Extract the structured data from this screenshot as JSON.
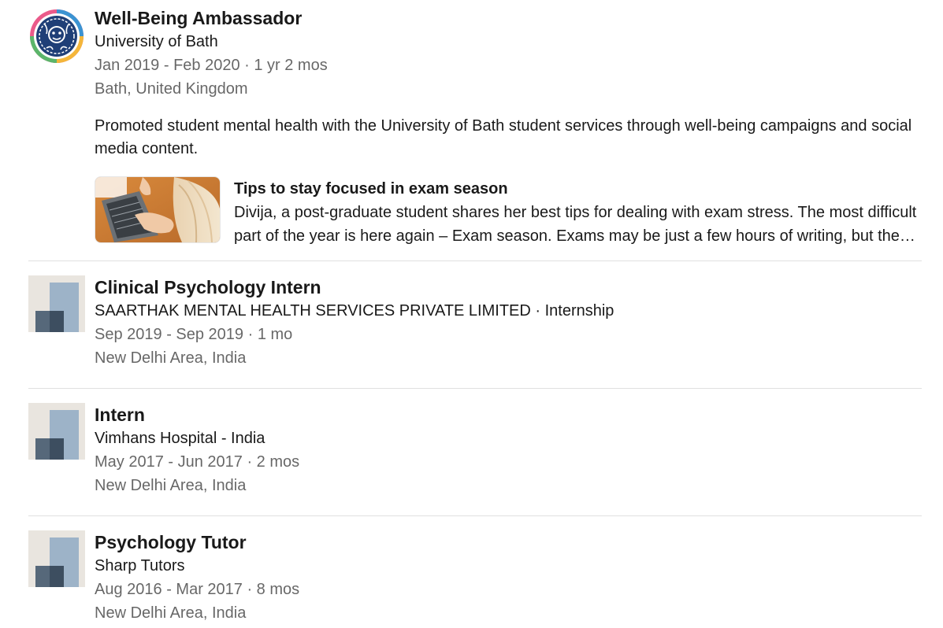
{
  "experience": [
    {
      "logo": "university-of-bath-logo",
      "title": "Well-Being Ambassador",
      "company": "University of Bath",
      "dates": "Jan 2019 - Feb 2020 · 1 yr 2 mos",
      "location": "Bath, United Kingdom",
      "description": "Promoted student mental health with the University of Bath student services through well-being campaigns and social media content.",
      "media": {
        "thumbnail": "laptop-study-photo",
        "title": "Tips to stay focused in exam season",
        "description": "Divija, a post-graduate student shares her best tips for dealing with exam stress. The most difficult part of the year is here again – Exam season. Exams may be just a few hours of writing, but the weeks leading up to them can be stressful."
      }
    },
    {
      "logo": "placeholder-company-icon",
      "title": "Clinical Psychology Intern",
      "company": "SAARTHAK MENTAL HEALTH SERVICES PRIVATE LIMITED · Internship",
      "dates": "Sep 2019 - Sep 2019 · 1 mo",
      "location": "New Delhi Area, India"
    },
    {
      "logo": "placeholder-company-icon",
      "title": "Intern",
      "company": "Vimhans Hospital - India",
      "dates": "May 2017 - Jun 2017 · 2 mos",
      "location": "New Delhi Area, India"
    },
    {
      "logo": "placeholder-company-icon",
      "title": "Psychology Tutor",
      "company": "Sharp Tutors",
      "dates": "Aug 2016 - Mar 2017 · 8 mos",
      "location": "New Delhi Area, India"
    }
  ],
  "colors": {
    "placeholder_bg": "#e9e5df",
    "placeholder_light": "#9db3c8",
    "placeholder_dark": "#56687a",
    "meta_text": "#666666",
    "divider": "#e0e0e0"
  }
}
